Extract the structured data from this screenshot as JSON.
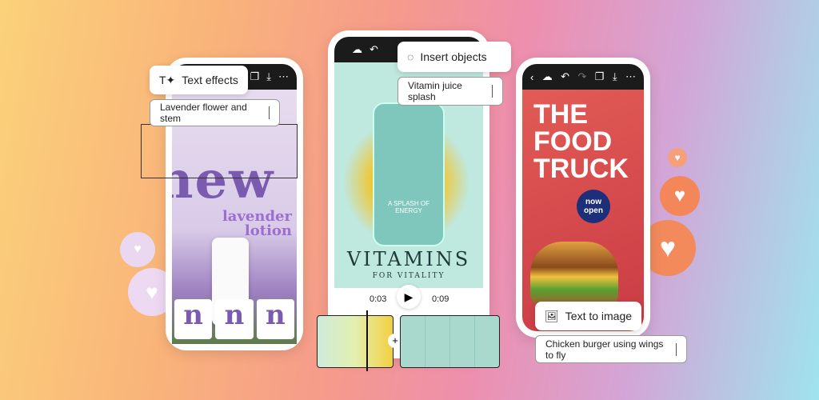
{
  "left_phone": {
    "tool_label": "Text effects",
    "prompt": "Lavender flower and stem",
    "headline": "new",
    "subtitle": "lavender lotion",
    "variants": [
      "n",
      "n",
      "n"
    ]
  },
  "middle_phone": {
    "tool_label": "Insert objects",
    "prompt": "Vitamin juice splash",
    "jar_text": "A SPLASH OF ENERGY",
    "title": "VITAMINS",
    "subtitle": "FOR VITALITY",
    "time_current": "0:03",
    "time_total": "0:09",
    "add_clip": "+"
  },
  "right_phone": {
    "title_lines": [
      "THE",
      "FOOD",
      "TRUCK"
    ],
    "badge": "now open",
    "tool_label": "Text to image",
    "prompt": "Chicken burger using wings to fly"
  },
  "icons": {
    "toolbar": [
      "back",
      "cloud",
      "undo",
      "redo",
      "layers",
      "download",
      "more"
    ]
  },
  "colors": {
    "lavender": "#7a5bb0",
    "teal": "#bfe8df",
    "food_red": "#d9474a",
    "heart": "#f07a4f"
  }
}
